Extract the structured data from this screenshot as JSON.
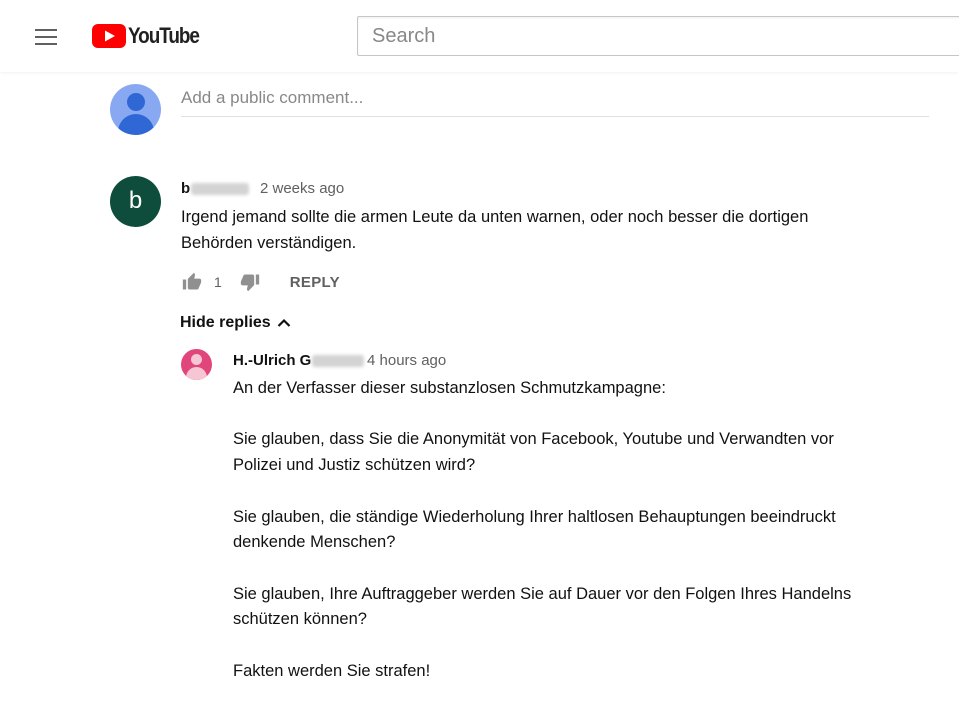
{
  "header": {
    "logo_text": "YouTube",
    "search_placeholder": "Search"
  },
  "add_comment": {
    "placeholder": "Add a public comment..."
  },
  "comment": {
    "avatar_letter": "b",
    "author_visible": "b",
    "time": "2 weeks ago",
    "text": "Irgend jemand sollte die armen Leute da unten warnen, oder noch besser die dortigen\nBehörden verständigen.",
    "likes": "1",
    "reply_label": "REPLY",
    "hide_replies_label": "Hide replies"
  },
  "reply": {
    "author_visible": "H.-Ulrich G",
    "time": "4 hours ago",
    "text": "An der Verfasser dieser substanzlosen Schmutzkampagne:\n\nSie glauben, dass Sie die Anonymität von Facebook, Youtube und Verwandten vor\nPolizei und Justiz schützen wird?\n\nSie glauben, die ständige Wiederholung Ihrer haltlosen Behauptungen beeindruckt\ndenkende Menschen?\n\nSie glauben, Ihre Auftraggeber werden Sie auf Dauer vor den Folgen Ihres Handelns\nschützen können?\n\nFakten werden Sie strafen!"
  },
  "colors": {
    "brand_red": "#ff0000",
    "comment_avatar": "#0e4d3b",
    "reply_avatar": "#e0467c",
    "self_avatar": "#88a9f2"
  }
}
